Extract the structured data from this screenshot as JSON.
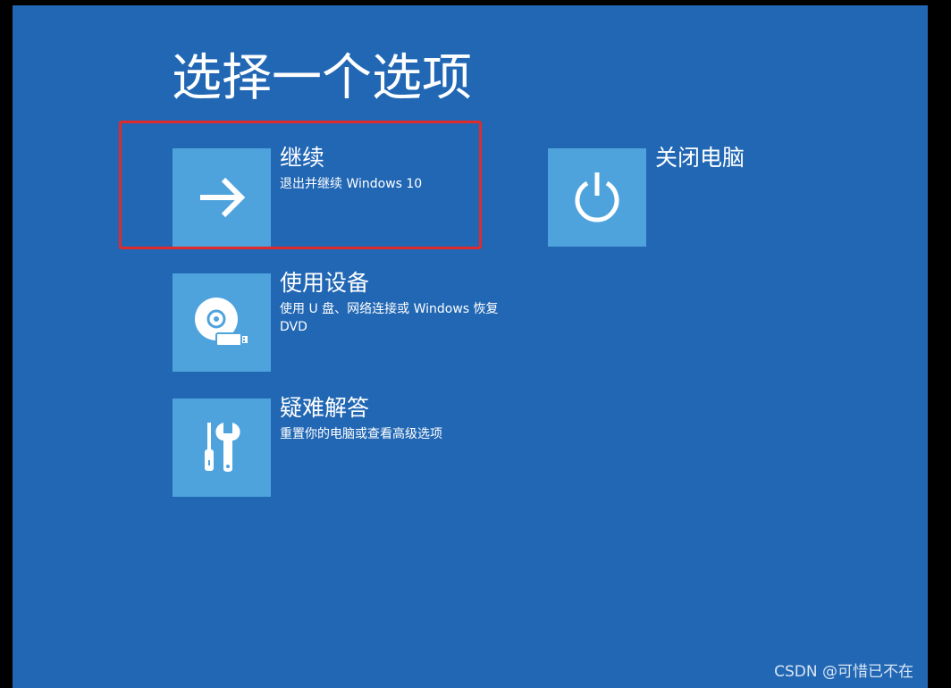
{
  "page_title": "选择一个选项",
  "options": [
    {
      "title": "继续",
      "description": "退出并继续 Windows 10",
      "icon": "arrow-right-icon"
    },
    {
      "title": "关闭电脑",
      "description": "",
      "icon": "power-icon"
    },
    {
      "title": "使用设备",
      "description": "使用 U 盘、网络连接或 Windows 恢复 DVD",
      "icon": "disc-usb-icon"
    },
    {
      "title": "疑难解答",
      "description": "重置你的电脑或查看高级选项",
      "icon": "tools-icon"
    }
  ],
  "watermark": "CSDN @可惜已不在",
  "colors": {
    "background": "#2167b4",
    "tile": "#4fa3dd",
    "highlight": "#e02b2b",
    "text": "#ffffff"
  }
}
